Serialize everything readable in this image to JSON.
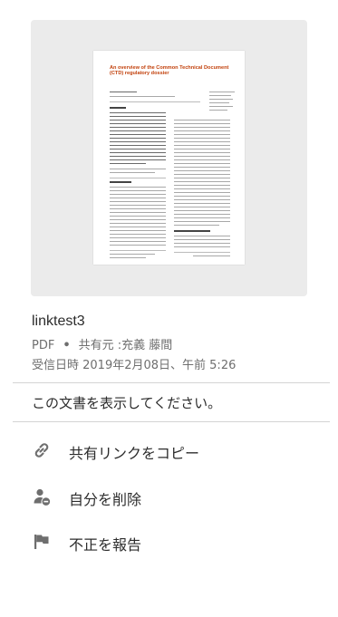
{
  "document": {
    "thumbnail": {
      "title": "An overview of the Common Technical Document (CTD) regulatory dossier"
    },
    "name": "linktest3",
    "type": "PDF",
    "shared_by": "共有元 :充義 藤間",
    "received": "受信日時 2019年2月08日、午前 5:26"
  },
  "message": "この文書を表示してください。",
  "actions": [
    {
      "label": "共有リンクをコピー",
      "icon": "link-icon"
    },
    {
      "label": "自分を削除",
      "icon": "remove-user-icon"
    },
    {
      "label": "不正を報告",
      "icon": "flag-icon"
    }
  ]
}
